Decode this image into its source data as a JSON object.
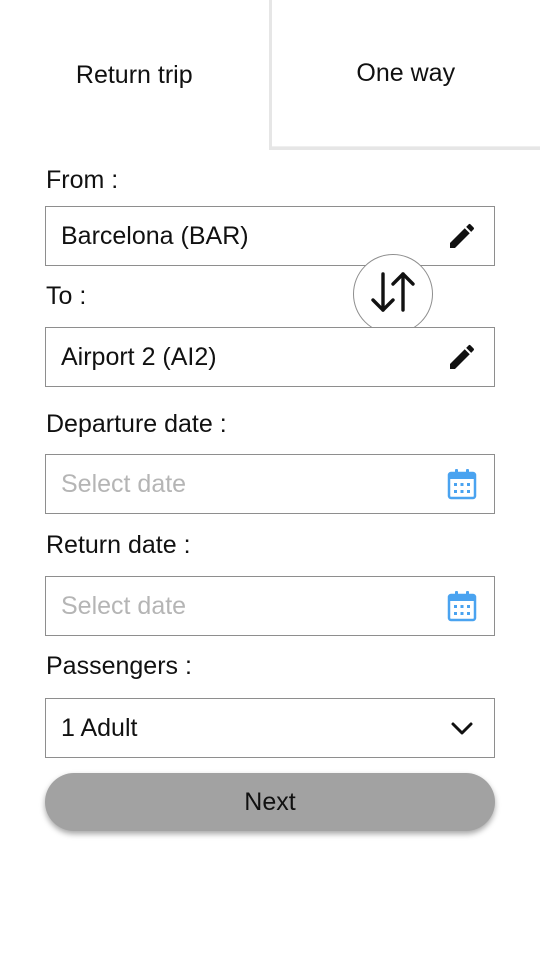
{
  "tabs": {
    "return_trip": "Return trip",
    "one_way": "One way"
  },
  "from": {
    "label": "From :",
    "value": "Barcelona (BAR)",
    "icon": "pencil-icon"
  },
  "to": {
    "label": "To :",
    "value": "Airport 2 (AI2)",
    "icon": "pencil-icon"
  },
  "swap": {
    "icon": "swap-vertical-icon"
  },
  "departure": {
    "label": "Departure date :",
    "placeholder": "Select date",
    "icon": "calendar-icon"
  },
  "return": {
    "label": "Return date :",
    "placeholder": "Select date",
    "icon": "calendar-icon"
  },
  "passengers": {
    "label": "Passengers :",
    "value": "1 Adult",
    "icon": "chevron-down-icon"
  },
  "next_label": "Next",
  "colors": {
    "calendar": "#4aa3f0",
    "button": "#a2a2a2",
    "border": "#8e8e8e",
    "placeholder": "#b5b5b5"
  }
}
